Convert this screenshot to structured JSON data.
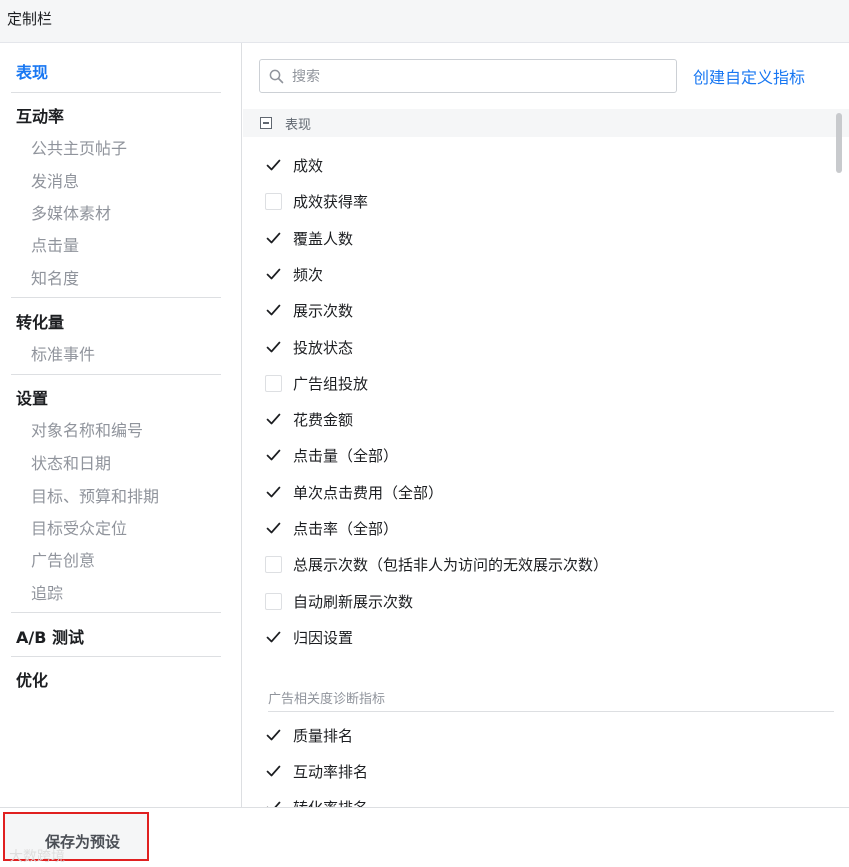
{
  "window": {
    "title": "定制栏"
  },
  "sidebar": {
    "groups": [
      {
        "label": "表现",
        "active": true,
        "items": []
      },
      {
        "label": "互动率",
        "items": [
          "公共主页帖子",
          "发消息",
          "多媒体素材",
          "点击量",
          "知名度"
        ]
      },
      {
        "label": "转化量",
        "items": [
          "标准事件"
        ]
      },
      {
        "label": "设置",
        "items": [
          "对象名称和编号",
          "状态和日期",
          "目标、预算和排期",
          "目标受众定位",
          "广告创意",
          "追踪"
        ]
      },
      {
        "label": "A/B 测试",
        "items": []
      },
      {
        "label": "优化",
        "items": []
      }
    ]
  },
  "search": {
    "placeholder": "搜索",
    "value": "",
    "icon": "search-icon"
  },
  "create_custom_metric": "创建自定义指标",
  "section": {
    "label": "表现",
    "items": [
      {
        "label": "成效",
        "checked": true
      },
      {
        "label": "成效获得率",
        "checked": false
      },
      {
        "label": "覆盖人数",
        "checked": true
      },
      {
        "label": "频次",
        "checked": true
      },
      {
        "label": "展示次数",
        "checked": true
      },
      {
        "label": "投放状态",
        "checked": true
      },
      {
        "label": "广告组投放",
        "checked": false
      },
      {
        "label": "花费金额",
        "checked": true
      },
      {
        "label": "点击量（全部）",
        "checked": true
      },
      {
        "label": "单次点击费用（全部）",
        "checked": true
      },
      {
        "label": "点击率（全部）",
        "checked": true
      },
      {
        "label": "总展示次数（包括非人为访问的无效展示次数）",
        "checked": false
      },
      {
        "label": "自动刷新展示次数",
        "checked": false
      },
      {
        "label": "归因设置",
        "checked": true
      }
    ]
  },
  "subsection": {
    "label": "广告相关度诊断指标",
    "items": [
      {
        "label": "质量排名",
        "checked": true
      },
      {
        "label": "互动率排名",
        "checked": true
      },
      {
        "label": "转化率排名",
        "checked": true
      }
    ]
  },
  "footer": {
    "save_preset": "保存为预设",
    "watermark": "大数跨境"
  },
  "colors": {
    "accent": "#1877f2",
    "highlight_border": "#e02020",
    "muted_text": "#90949c"
  }
}
